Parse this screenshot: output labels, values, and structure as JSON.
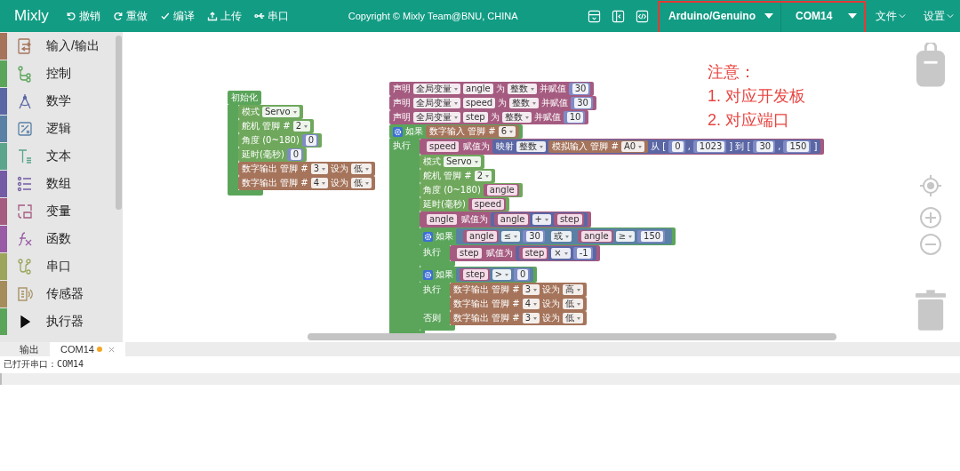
{
  "app_bar": {
    "app_name": "Mixly",
    "highlighted": true,
    "actions": [
      {
        "label": "撤销"
      },
      {
        "label": "重做"
      },
      {
        "label": "编译"
      },
      {
        "label": "上传"
      },
      {
        "label": "串口"
      }
    ],
    "copyright": "Copyright © Mixly Team@BNU, CHINA",
    "board": "Arduino/Genuino",
    "port": "COM14",
    "menus": [
      {
        "label": "文件"
      },
      {
        "label": "设置"
      }
    ]
  },
  "sidebar": {
    "items": [
      {
        "label": "输入/输出",
        "color": "#a5745b",
        "kind": "category"
      },
      {
        "label": "控制",
        "color": "#5ba55b",
        "kind": "category"
      },
      {
        "label": "数学",
        "color": "#5b67a5",
        "kind": "category"
      },
      {
        "label": "逻辑",
        "color": "#5b80a5",
        "kind": "category"
      },
      {
        "label": "文本",
        "color": "#5ba58c",
        "kind": "category"
      },
      {
        "label": "数组",
        "color": "#745ba5",
        "kind": "category"
      },
      {
        "label": "变量",
        "color": "#a55b80",
        "kind": "category"
      },
      {
        "label": "函数",
        "color": "#995ba5",
        "kind": "category"
      },
      {
        "label": "串口",
        "color": "#9ca55b",
        "kind": "category"
      },
      {
        "label": "传感器",
        "color": "#a58c5b",
        "kind": "category"
      },
      {
        "label": "执行器",
        "color": "#5ba55b",
        "kind": "folder"
      }
    ]
  },
  "annotation": {
    "title": "注意：",
    "lines": [
      "1. 对应开发板",
      "2. 对应端口"
    ]
  },
  "workspace": {
    "groups": [
      {
        "blocks": [
          {
            "kind": "block",
            "color": "#5ba55b",
            "lines": [
              {
                "parts": [
                  {
                    "kind": "label",
                    "text": "初始化"
                  }
                ]
              },
              {
                "body": [
                  {
                    "kind": "block",
                    "color": "#6fa85c",
                    "lines": [
                      {
                        "parts": [
                          {
                            "kind": "label",
                            "text": "模式"
                          },
                          {
                            "kind": "dropdown",
                            "text": "Servo"
                          }
                        ]
                      },
                      {
                        "parts": [
                          {
                            "kind": "label",
                            "text": "舵机 管脚 #"
                          },
                          {
                            "kind": "dropdown",
                            "text": "2"
                          }
                        ]
                      },
                      {
                        "parts": [
                          {
                            "kind": "label",
                            "text": "角度 (0~180)"
                          },
                          {
                            "kind": "num",
                            "text": "0"
                          }
                        ]
                      },
                      {
                        "parts": [
                          {
                            "kind": "label",
                            "text": "延时(毫秒)"
                          },
                          {
                            "kind": "num",
                            "text": "0"
                          }
                        ]
                      }
                    ]
                  },
                  {
                    "kind": "block",
                    "color": "#a5745b",
                    "lines": [
                      {
                        "parts": [
                          {
                            "kind": "label",
                            "text": "数字输出 管脚 #"
                          },
                          {
                            "kind": "dropdown",
                            "text": "3"
                          },
                          {
                            "kind": "label",
                            "text": "设为"
                          },
                          {
                            "kind": "dropdown",
                            "text": "低"
                          }
                        ]
                      }
                    ]
                  },
                  {
                    "kind": "block",
                    "color": "#a5745b",
                    "lines": [
                      {
                        "parts": [
                          {
                            "kind": "label",
                            "text": "数字输出 管脚 #"
                          },
                          {
                            "kind": "dropdown",
                            "text": "4"
                          },
                          {
                            "kind": "label",
                            "text": "设为"
                          },
                          {
                            "kind": "dropdown",
                            "text": "低"
                          }
                        ]
                      }
                    ]
                  }
                ]
              }
            ]
          }
        ]
      },
      {
        "blocks": [
          {
            "kind": "block",
            "color": "#a55b80",
            "lines": [
              {
                "parts": [
                  {
                    "kind": "label",
                    "text": "声明"
                  },
                  {
                    "kind": "dropdown",
                    "text": "全局变量"
                  },
                  {
                    "kind": "input",
                    "text": "angle"
                  },
                  {
                    "kind": "label",
                    "text": "为"
                  },
                  {
                    "kind": "dropdown",
                    "text": "整数"
                  },
                  {
                    "kind": "label",
                    "text": "并赋值"
                  },
                  {
                    "kind": "num",
                    "text": "30"
                  }
                ]
              }
            ]
          },
          {
            "kind": "block",
            "color": "#a55b80",
            "lines": [
              {
                "parts": [
                  {
                    "kind": "label",
                    "text": "声明"
                  },
                  {
                    "kind": "dropdown",
                    "text": "全局变量"
                  },
                  {
                    "kind": "input",
                    "text": "speed"
                  },
                  {
                    "kind": "label",
                    "text": "为"
                  },
                  {
                    "kind": "dropdown",
                    "text": "整数"
                  },
                  {
                    "kind": "label",
                    "text": "并赋值"
                  },
                  {
                    "kind": "num",
                    "text": "30"
                  }
                ]
              }
            ]
          },
          {
            "kind": "block",
            "color": "#a55b80",
            "lines": [
              {
                "parts": [
                  {
                    "kind": "label",
                    "text": "声明"
                  },
                  {
                    "kind": "dropdown",
                    "text": "全局变量"
                  },
                  {
                    "kind": "input",
                    "text": "step"
                  },
                  {
                    "kind": "label",
                    "text": "为"
                  },
                  {
                    "kind": "dropdown",
                    "text": "整数"
                  },
                  {
                    "kind": "label",
                    "text": "并赋值"
                  },
                  {
                    "kind": "num",
                    "text": "10"
                  }
                ]
              }
            ]
          },
          {
            "kind": "if",
            "color": "#5ba55b",
            "lines": [
              {
                "parts": [
                  {
                    "kind": "label",
                    "text": "如果"
                  },
                  {
                    "kind": "block",
                    "color": "#a5745b",
                    "parts": [
                      {
                        "kind": "label",
                        "text": "数字输入 管脚 #"
                      },
                      {
                        "kind": "dropdown",
                        "text": "6"
                      }
                    ]
                  }
                ]
              },
              {
                "parts": [
                  {
                    "kind": "label",
                    "text": "执行"
                  }
                ],
                "body": [
                  {
                    "kind": "block",
                    "color": "#a55b80",
                    "lines": [
                      {
                        "parts": [
                          {
                            "kind": "var",
                            "text": "speed"
                          },
                          {
                            "kind": "label",
                            "text": "赋值为"
                          },
                          {
                            "kind": "block",
                            "color": "#5b67a5",
                            "parts": [
                              {
                                "kind": "label",
                                "text": "映射"
                              },
                              {
                                "kind": "dropdown",
                                "text": "整数"
                              },
                              {
                                "kind": "block",
                                "color": "#a5745b",
                                "parts": [
                                  {
                                    "kind": "label",
                                    "text": "模拟输入 管脚 #"
                                  },
                                  {
                                    "kind": "dropdown",
                                    "text": "A0"
                                  }
                                ]
                              },
                              {
                                "kind": "label",
                                "text": "从 ["
                              },
                              {
                                "kind": "num",
                                "text": "0"
                              },
                              {
                                "kind": "label",
                                "text": ","
                              },
                              {
                                "kind": "num",
                                "text": "1023"
                              },
                              {
                                "kind": "label",
                                "text": "] 到 ["
                              },
                              {
                                "kind": "num",
                                "text": "30"
                              },
                              {
                                "kind": "label",
                                "text": ","
                              },
                              {
                                "kind": "num",
                                "text": "150"
                              },
                              {
                                "kind": "label",
                                "text": "]"
                              }
                            ]
                          }
                        ]
                      }
                    ]
                  },
                  {
                    "kind": "block",
                    "color": "#6fa85c",
                    "lines": [
                      {
                        "parts": [
                          {
                            "kind": "label",
                            "text": "模式"
                          },
                          {
                            "kind": "dropdown",
                            "text": "Servo"
                          }
                        ]
                      },
                      {
                        "parts": [
                          {
                            "kind": "label",
                            "text": "舵机 管脚 #"
                          },
                          {
                            "kind": "dropdown",
                            "text": "2"
                          }
                        ]
                      },
                      {
                        "parts": [
                          {
                            "kind": "label",
                            "text": "角度 (0~180)"
                          },
                          {
                            "kind": "var",
                            "text": "angle"
                          }
                        ]
                      },
                      {
                        "parts": [
                          {
                            "kind": "label",
                            "text": "延时(毫秒)"
                          },
                          {
                            "kind": "var",
                            "text": "speed"
                          }
                        ]
                      }
                    ]
                  },
                  {
                    "kind": "block",
                    "color": "#a55b80",
                    "lines": [
                      {
                        "parts": [
                          {
                            "kind": "var",
                            "text": "angle"
                          },
                          {
                            "kind": "label",
                            "text": "赋值为"
                          },
                          {
                            "kind": "block",
                            "color": "#5b67a5",
                            "parts": [
                              {
                                "kind": "var",
                                "text": "angle"
                              },
                              {
                                "kind": "dropdown",
                                "text": "+"
                              },
                              {
                                "kind": "var",
                                "text": "step"
                              }
                            ]
                          }
                        ]
                      }
                    ]
                  },
                  {
                    "kind": "if",
                    "color": "#5ba55b",
                    "lines": [
                      {
                        "parts": [
                          {
                            "kind": "label",
                            "text": "如果"
                          },
                          {
                            "kind": "block",
                            "color": "#5b80a5",
                            "parts": [
                              {
                                "kind": "block",
                                "color": "#5b80a5",
                                "parts": [
                                  {
                                    "kind": "var",
                                    "text": "angle"
                                  },
                                  {
                                    "kind": "dropdown",
                                    "text": "≤"
                                  },
                                  {
                                    "kind": "num",
                                    "text": "30"
                                  }
                                ]
                              },
                              {
                                "kind": "dropdown",
                                "text": "或"
                              },
                              {
                                "kind": "block",
                                "color": "#5b80a5",
                                "parts": [
                                  {
                                    "kind": "var",
                                    "text": "angle"
                                  },
                                  {
                                    "kind": "dropdown",
                                    "text": "≥"
                                  },
                                  {
                                    "kind": "num",
                                    "text": "150"
                                  }
                                ]
                              }
                            ]
                          }
                        ]
                      },
                      {
                        "parts": [
                          {
                            "kind": "label",
                            "text": "执行"
                          }
                        ],
                        "body": [
                          {
                            "kind": "block",
                            "color": "#a55b80",
                            "lines": [
                              {
                                "parts": [
                                  {
                                    "kind": "var",
                                    "text": "step"
                                  },
                                  {
                                    "kind": "label",
                                    "text": "赋值为"
                                  },
                                  {
                                    "kind": "block",
                                    "color": "#5b67a5",
                                    "parts": [
                                      {
                                        "kind": "var",
                                        "text": "step"
                                      },
                                      {
                                        "kind": "dropdown",
                                        "text": "×"
                                      },
                                      {
                                        "kind": "num",
                                        "text": "-1"
                                      }
                                    ]
                                  }
                                ]
                              }
                            ]
                          }
                        ]
                      }
                    ]
                  },
                  {
                    "kind": "if",
                    "color": "#5ba55b",
                    "lines": [
                      {
                        "parts": [
                          {
                            "kind": "label",
                            "text": "如果"
                          },
                          {
                            "kind": "block",
                            "color": "#5b80a5",
                            "parts": [
                              {
                                "kind": "var",
                                "text": "step"
                              },
                              {
                                "kind": "dropdown",
                                "text": ">"
                              },
                              {
                                "kind": "num",
                                "text": "0"
                              }
                            ]
                          }
                        ]
                      },
                      {
                        "parts": [
                          {
                            "kind": "label",
                            "text": "执行"
                          }
                        ],
                        "body": [
                          {
                            "kind": "block",
                            "color": "#a5745b",
                            "lines": [
                              {
                                "parts": [
                                  {
                                    "kind": "label",
                                    "text": "数字输出 管脚 #"
                                  },
                                  {
                                    "kind": "dropdown",
                                    "text": "3"
                                  },
                                  {
                                    "kind": "label",
                                    "text": "设为"
                                  },
                                  {
                                    "kind": "dropdown",
                                    "text": "高"
                                  }
                                ]
                              }
                            ]
                          },
                          {
                            "kind": "block",
                            "color": "#a5745b",
                            "lines": [
                              {
                                "parts": [
                                  {
                                    "kind": "label",
                                    "text": "数字输出 管脚 #"
                                  },
                                  {
                                    "kind": "dropdown",
                                    "text": "4"
                                  },
                                  {
                                    "kind": "label",
                                    "text": "设为"
                                  },
                                  {
                                    "kind": "dropdown",
                                    "text": "低"
                                  }
                                ]
                              }
                            ]
                          }
                        ]
                      },
                      {
                        "parts": [
                          {
                            "kind": "label",
                            "text": "否则"
                          }
                        ],
                        "body": [
                          {
                            "kind": "block",
                            "color": "#a5745b",
                            "lines": [
                              {
                                "parts": [
                                  {
                                    "kind": "label",
                                    "text": "数字输出 管脚 #"
                                  },
                                  {
                                    "kind": "dropdown",
                                    "text": "3"
                                  },
                                  {
                                    "kind": "label",
                                    "text": "设为"
                                  },
                                  {
                                    "kind": "dropdown",
                                    "text": "低"
                                  }
                                ]
                              }
                            ]
                          }
                        ]
                      }
                    ]
                  }
                ]
              }
            ]
          }
        ]
      }
    ]
  },
  "output": {
    "tabs": [
      {
        "label": "输出",
        "selected": false,
        "modified": false
      },
      {
        "label": "COM14",
        "selected": true,
        "modified": true
      }
    ],
    "lines": [
      "已打开串口：COM14"
    ]
  }
}
